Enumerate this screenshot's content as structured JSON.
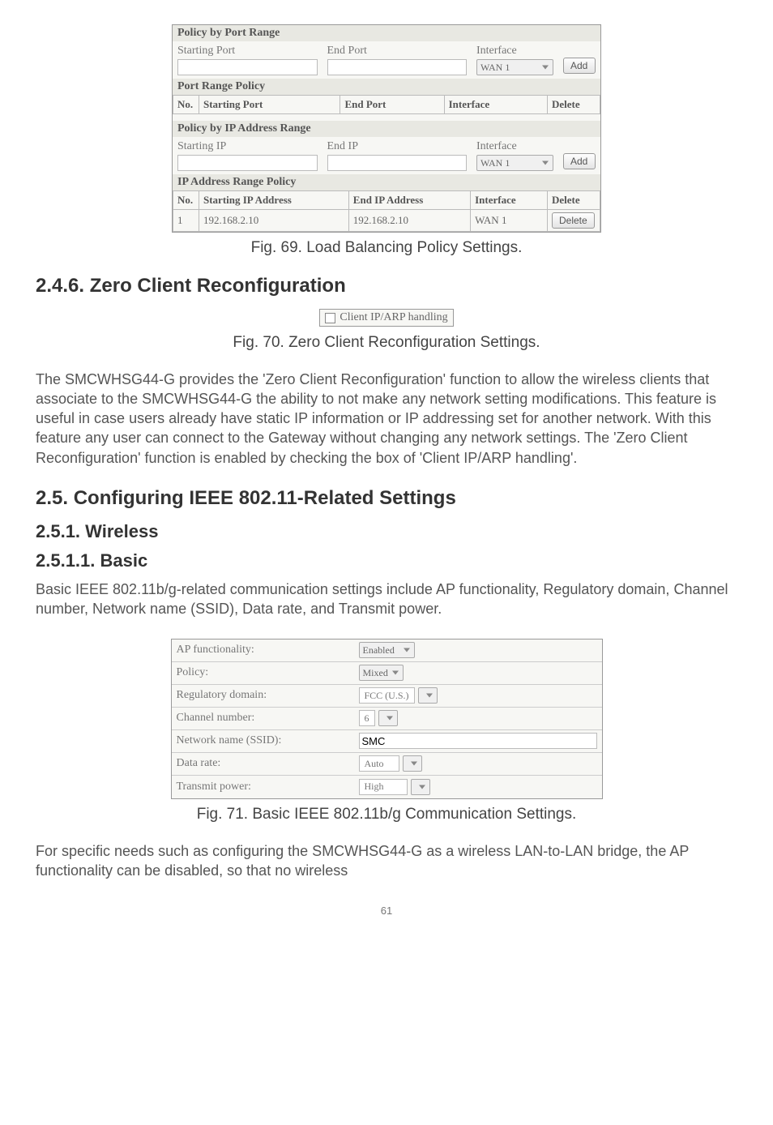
{
  "fig1": {
    "section1_title": "Policy by Port Range",
    "starting_port_label": "Starting Port",
    "end_port_label": "End Port",
    "interface_label": "Interface",
    "interface_value": "WAN 1",
    "add_btn": "Add",
    "section2_title": "Port Range Policy",
    "table1": {
      "headers": [
        "No.",
        "Starting Port",
        "End Port",
        "Interface",
        "Delete"
      ]
    },
    "section3_title": "Policy by IP Address Range",
    "starting_ip_label": "Starting IP",
    "end_ip_label": "End IP",
    "section4_title": "IP Address Range Policy",
    "table2": {
      "headers": [
        "No.",
        "Starting IP Address",
        "End IP Address",
        "Interface",
        "Delete"
      ],
      "row": {
        "no": "1",
        "start": "192.168.2.10",
        "end": "192.168.2.10",
        "iface": "WAN 1",
        "del": "Delete"
      }
    }
  },
  "fig1_caption": "Fig. 69. Load Balancing Policy Settings.",
  "h246": "2.4.6. Zero Client Reconfiguration",
  "clientip_label": "Client IP/ARP handling",
  "fig2_caption": "Fig. 70. Zero Client Reconfiguration Settings.",
  "p1": "The SMCWHSG44-G provides the 'Zero Client Reconfiguration' function to allow the wireless clients that associate to the SMCWHSG44-G the ability to not make any network setting modifications. This feature is useful in case users already have static IP information or IP addressing set for another network. With this feature any user can connect to the Gateway without changing any network settings. The 'Zero Client Reconfiguration' function is enabled by checking the box of 'Client IP/ARP handling'.",
  "h25": "2.5. Configuring IEEE 802.11-Related Settings",
  "h251": "2.5.1. Wireless",
  "h2511": "2.5.1.1. Basic",
  "p2": "Basic IEEE 802.11b/g-related communication settings include AP functionality, Regulatory domain, Channel number, Network name (SSID), Data rate, and Transmit power.",
  "fig3": {
    "rows": [
      {
        "label": "AP functionality:",
        "value": "Enabled",
        "type": "sel"
      },
      {
        "label": "Policy:",
        "value": "Mixed",
        "type": "sel"
      },
      {
        "label": "Regulatory domain:",
        "value": "FCC (U.S.)",
        "type": "sel"
      },
      {
        "label": "Channel number:",
        "value": "6",
        "type": "selnum"
      },
      {
        "label": "Network name (SSID):",
        "value": "SMC",
        "type": "text"
      },
      {
        "label": "Data rate:",
        "value": "Auto",
        "type": "sel"
      },
      {
        "label": "Transmit power:",
        "value": "High",
        "type": "sel"
      }
    ]
  },
  "fig3_caption": "Fig. 71. Basic IEEE 802.11b/g Communication Settings.",
  "p3": "For specific needs such as configuring the SMCWHSG44-G as a wireless LAN-to-LAN bridge, the AP functionality can be disabled, so that no wireless",
  "pagenum": "61"
}
